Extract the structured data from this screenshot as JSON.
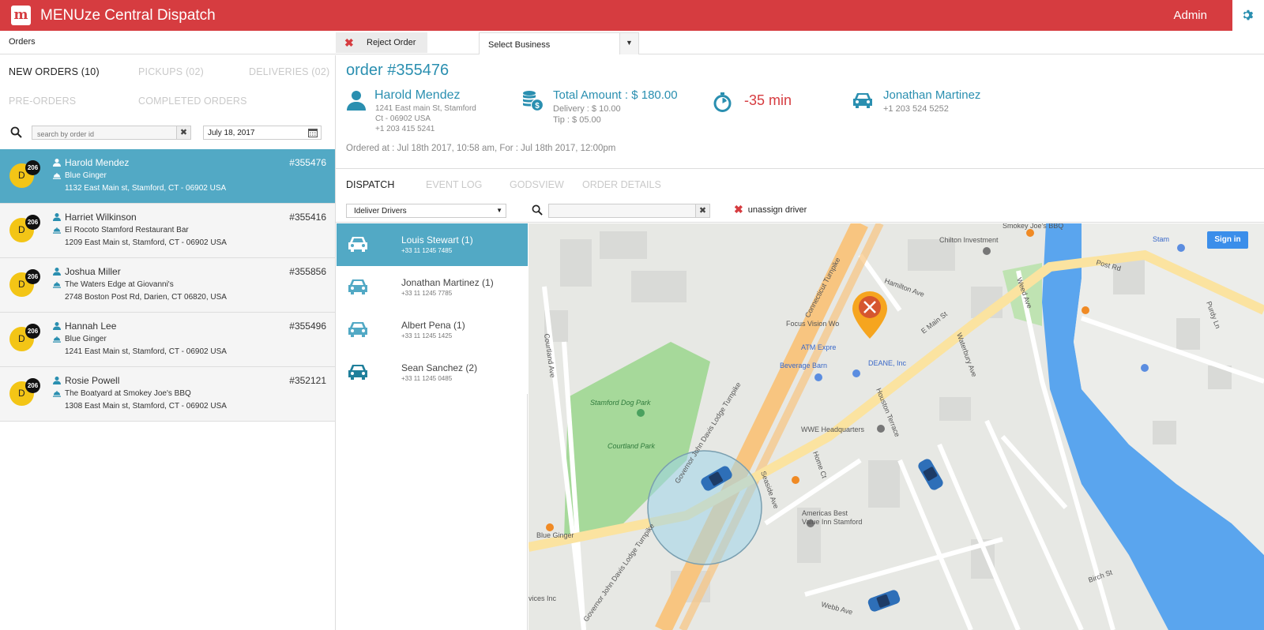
{
  "app": {
    "logo_letter": "m",
    "title": "MENUze Central Dispatch",
    "user": "Admin",
    "settings_icon": "gear-icon"
  },
  "toolbar": {
    "orders_label": "Orders",
    "reject_label": "Reject Order",
    "business_placeholder": "Select Business"
  },
  "order_tabs": {
    "new_orders": "NEW ORDERS (10)",
    "pickups": "PICKUPS (02)",
    "deliveries": "DELIVERIES (02)",
    "pre_orders": "PRE-ORDERS",
    "completed": "COMPLETED",
    "orders": "ORDERS"
  },
  "search": {
    "placeholder": "search by order id",
    "date": "July 18, 2017"
  },
  "orders": [
    {
      "badge_letter": "D",
      "badge_num": "206",
      "name": "Harold Mendez",
      "restaurant": "Blue Ginger",
      "address": "1132 East Main st, Stamford, CT - 06902 USA",
      "id": "#355476"
    },
    {
      "badge_letter": "D",
      "badge_num": "206",
      "name": "Harriet Wilkinson",
      "restaurant": "El Rocoto Stamford Restaurant Bar",
      "address": "1209 East Main st, Stamford, CT - 06902 USA",
      "id": "#355416"
    },
    {
      "badge_letter": "D",
      "badge_num": "206",
      "name": "Joshua Miller",
      "restaurant": "The Waters Edge at Giovanni's",
      "address": "2748 Boston Post Rd, Darien, CT 06820, USA",
      "id": "#355856"
    },
    {
      "badge_letter": "D",
      "badge_num": "206",
      "name": "Hannah Lee",
      "restaurant": "Blue Ginger",
      "address": "1241 East Main st, Stamford, CT - 06902 USA",
      "id": "#355496"
    },
    {
      "badge_letter": "D",
      "badge_num": "206",
      "name": "Rosie Powell",
      "restaurant": "The Boatyard at Smokey Joe's BBQ",
      "address": "1308 East Main st, Stamford, CT - 06902 USA",
      "id": "#352121"
    }
  ],
  "detail": {
    "title": "order #355476",
    "customer": {
      "name": "Harold Mendez",
      "line1": "1241 East main St, Stamford",
      "line2": "Ct - 06902 USA",
      "phone": "+1 203 415 5241"
    },
    "payment": {
      "total": "Total Amount : $ 180.00",
      "delivery": "Delivery : $ 10.00",
      "tip": "Tip : $ 05.00"
    },
    "timer": "-35 min",
    "driver": {
      "name": "Jonathan Martinez",
      "phone": "+1 203 524 5252"
    },
    "ordered_at": "Ordered at : Jul 18th 2017, 10:58 am, For : Jul 18th 2017, 12:00pm"
  },
  "detail_tabs": {
    "dispatch": "DISPATCH",
    "event_log": "EVENT LOG",
    "godsview": "GODSVIEW",
    "order_details": "ORDER DETAILS"
  },
  "dispatch": {
    "driver_group": "Ideliver Drivers",
    "unassign": "unassign driver"
  },
  "drivers": [
    {
      "name": "Louis Stewart (1)",
      "phone": "+33 11 1245 7485",
      "color": "#ffffff"
    },
    {
      "name": "Jonathan Martinez (1)",
      "phone": "+33 11 1245 7785",
      "color": "#52a9c5"
    },
    {
      "name": "Albert Pena (1)",
      "phone": "+33 11 1245 1425",
      "color": "#52a9c5"
    },
    {
      "name": "Sean Sanchez (2)",
      "phone": "+33 11 1245 0485",
      "color": "#1f7f9b"
    }
  ],
  "map": {
    "sign_in": "Sign in",
    "labels": {
      "smokey": "Smokey Joe's BBQ",
      "chilton": "Chilton Investment",
      "post_rd": "Post Rd",
      "hamilton": "Hamilton Ave",
      "connecticut": "Connecticut Turnpike",
      "focus": "Focus Vision Wo",
      "atm": "ATM Expre",
      "e_main": "E Main St",
      "beverage": "Beverage Barn",
      "deane": "DEANE, Inc",
      "courtland_ave": "Courtland Ave",
      "dogpark": "Stamford Dog Park",
      "courtland_park": "Courtland Park",
      "gov1": "Governor John Davis Lodge Turnpike",
      "gov2": "Governor John Davis Lodge Turnpike",
      "houston": "Houston Terrace",
      "waterbury": "Waterbury Ave",
      "weed": "Weed Ave",
      "purdy": "Purdy Ln",
      "wwe": "WWE Headquarters",
      "seaside": "Seaside Ave",
      "home_ct": "Home Ct",
      "americas": "Americas Best",
      "value_inn": "Value Inn Stamford",
      "blue_ginger": "Blue Ginger",
      "webb": "Webb Ave",
      "birch": "Birch St",
      "services": "vices Inc",
      "stam": "Stam"
    },
    "water_color": "#5aa5ee",
    "park_color": "#a6d99a",
    "highway_color": "#f8c580"
  }
}
